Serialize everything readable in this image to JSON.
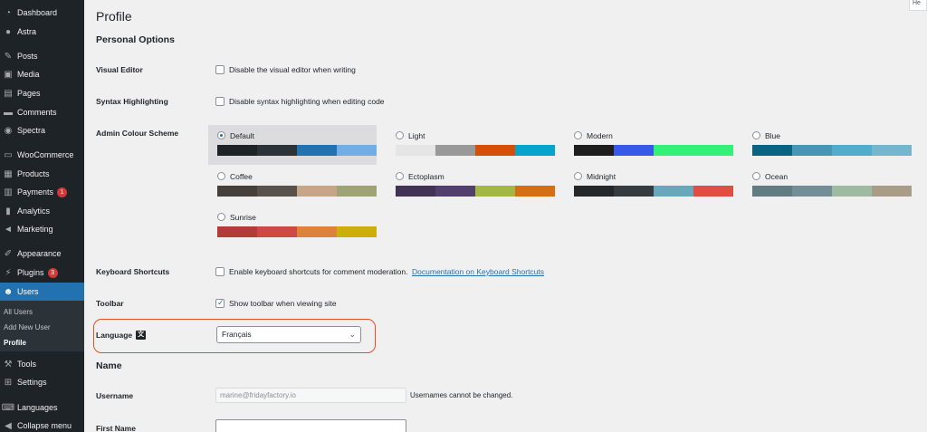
{
  "sidebar": {
    "items": [
      {
        "label": "Dashboard",
        "icon": "dashboard-icon",
        "glyph": "◔"
      },
      {
        "label": "Astra",
        "icon": "astra-icon",
        "glyph": "●"
      },
      {
        "label": "Posts",
        "icon": "pin-icon",
        "glyph": "✎"
      },
      {
        "label": "Media",
        "icon": "media-icon",
        "glyph": "▣"
      },
      {
        "label": "Pages",
        "icon": "pages-icon",
        "glyph": "▤"
      },
      {
        "label": "Comments",
        "icon": "comments-icon",
        "glyph": "▬"
      },
      {
        "label": "Spectra",
        "icon": "spectra-icon",
        "glyph": "◉"
      },
      {
        "label": "WooCommerce",
        "icon": "woocommerce-icon",
        "glyph": "▭"
      },
      {
        "label": "Products",
        "icon": "products-icon",
        "glyph": "▦"
      },
      {
        "label": "Payments",
        "icon": "payments-icon",
        "glyph": "▥",
        "badge": "1"
      },
      {
        "label": "Analytics",
        "icon": "analytics-icon",
        "glyph": "▮"
      },
      {
        "label": "Marketing",
        "icon": "megaphone-icon",
        "glyph": "◄"
      },
      {
        "label": "Appearance",
        "icon": "brush-icon",
        "glyph": "✐"
      },
      {
        "label": "Plugins",
        "icon": "plugin-icon",
        "glyph": "⚡",
        "badge": "3"
      },
      {
        "label": "Users",
        "icon": "users-icon",
        "glyph": "☻"
      },
      {
        "label": "Tools",
        "icon": "wrench-icon",
        "glyph": "⚒"
      },
      {
        "label": "Settings",
        "icon": "settings-icon",
        "glyph": "⊞"
      },
      {
        "label": "Languages",
        "icon": "languages-icon",
        "glyph": "⌨"
      },
      {
        "label": "Collapse menu",
        "icon": "collapse-icon",
        "glyph": "◀"
      }
    ],
    "submenu": [
      "All Users",
      "Add New User",
      "Profile"
    ]
  },
  "help_tab": "He",
  "page": {
    "title": "Profile",
    "personal_options": "Personal Options",
    "visual_editor": {
      "label": "Visual Editor",
      "option": "Disable the visual editor when writing",
      "checked": false
    },
    "syntax": {
      "label": "Syntax Highlighting",
      "option": "Disable syntax highlighting when editing code",
      "checked": false
    },
    "colour_scheme": {
      "label": "Admin Colour Scheme",
      "selected": "Default",
      "schemes": [
        {
          "name": "Default",
          "colors": [
            "#1d2327",
            "#2c3338",
            "#2271b1",
            "#72aee6"
          ]
        },
        {
          "name": "Light",
          "colors": [
            "#e5e5e5",
            "#999999",
            "#d64e07",
            "#04a4cc"
          ]
        },
        {
          "name": "Modern",
          "colors": [
            "#1e1e1e",
            "#3858e9",
            "#33f078",
            "#33f078"
          ]
        },
        {
          "name": "Blue",
          "colors": [
            "#096484",
            "#4796b3",
            "#52accc",
            "#74b6ce"
          ]
        },
        {
          "name": "Coffee",
          "colors": [
            "#46403c",
            "#59524c",
            "#c7a589",
            "#9ea476"
          ]
        },
        {
          "name": "Ectoplasm",
          "colors": [
            "#413256",
            "#523f6d",
            "#a3b745",
            "#d46f15"
          ]
        },
        {
          "name": "Midnight",
          "colors": [
            "#25282b",
            "#363b3f",
            "#69a8bb",
            "#e14d43"
          ]
        },
        {
          "name": "Ocean",
          "colors": [
            "#627c83",
            "#738e96",
            "#9ebaa0",
            "#aa9d88"
          ]
        },
        {
          "name": "Sunrise",
          "colors": [
            "#b43c38",
            "#cf4944",
            "#dd823b",
            "#ccaf0b"
          ]
        }
      ]
    },
    "keyboard": {
      "label": "Keyboard Shortcuts",
      "option": "Enable keyboard shortcuts for comment moderation.",
      "link": "Documentation on Keyboard Shortcuts",
      "checked": false
    },
    "toolbar": {
      "label": "Toolbar",
      "option": "Show toolbar when viewing site",
      "checked": true
    },
    "language": {
      "label": "Language",
      "value": "Français",
      "icon": "translate-icon"
    },
    "name_section": "Name",
    "username": {
      "label": "Username",
      "value": "marine@fridayfactory.io",
      "help": "Usernames cannot be changed."
    },
    "first_name": {
      "label": "First Name",
      "value": ""
    }
  },
  "colors": {
    "accent": "#2271b1",
    "highlight_outline": "#e2501f",
    "sidebar_bg": "#1d2327"
  }
}
